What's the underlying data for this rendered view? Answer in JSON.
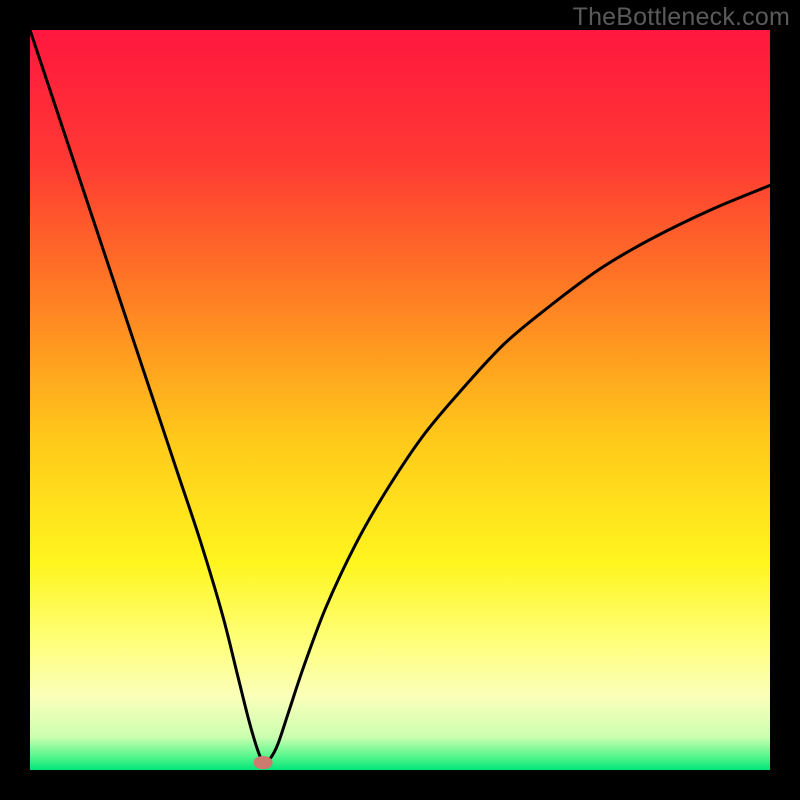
{
  "watermark": "TheBottleneck.com",
  "chart_data": {
    "type": "line",
    "title": "",
    "xlabel": "",
    "ylabel": "",
    "xlim": [
      0,
      100
    ],
    "ylim": [
      0,
      100
    ],
    "grid": false,
    "legend": false,
    "gradient_stops": [
      {
        "pos": 0.0,
        "color": "#ff173f"
      },
      {
        "pos": 0.18,
        "color": "#ff3a33"
      },
      {
        "pos": 0.35,
        "color": "#ff7a24"
      },
      {
        "pos": 0.55,
        "color": "#ffc81a"
      },
      {
        "pos": 0.72,
        "color": "#fff51e"
      },
      {
        "pos": 0.82,
        "color": "#ffff75"
      },
      {
        "pos": 0.9,
        "color": "#fbffb9"
      },
      {
        "pos": 0.955,
        "color": "#ccffb0"
      },
      {
        "pos": 0.98,
        "color": "#5ef78f"
      },
      {
        "pos": 1.0,
        "color": "#00e67a"
      }
    ],
    "series": [
      {
        "name": "curve",
        "x": [
          0,
          2,
          5,
          8,
          11,
          14,
          17,
          20,
          23,
          26,
          28,
          29.5,
          30.5,
          31.2,
          31.8,
          32.5,
          33.5,
          35,
          37,
          40,
          44,
          48,
          53,
          58,
          64,
          70,
          77,
          84,
          92,
          100
        ],
        "y": [
          100,
          94,
          85,
          76,
          67,
          58,
          49,
          40,
          31,
          21,
          13,
          7,
          3.5,
          1.6,
          1.2,
          1.6,
          3.5,
          8,
          14,
          22,
          30.5,
          37.5,
          45,
          51,
          57.5,
          62.5,
          67.7,
          71.8,
          75.7,
          79
        ]
      }
    ],
    "marker": {
      "x": 31.5,
      "y": 1.0,
      "rx": 1.3,
      "ry": 0.9,
      "color": "#cd7a6f"
    }
  }
}
